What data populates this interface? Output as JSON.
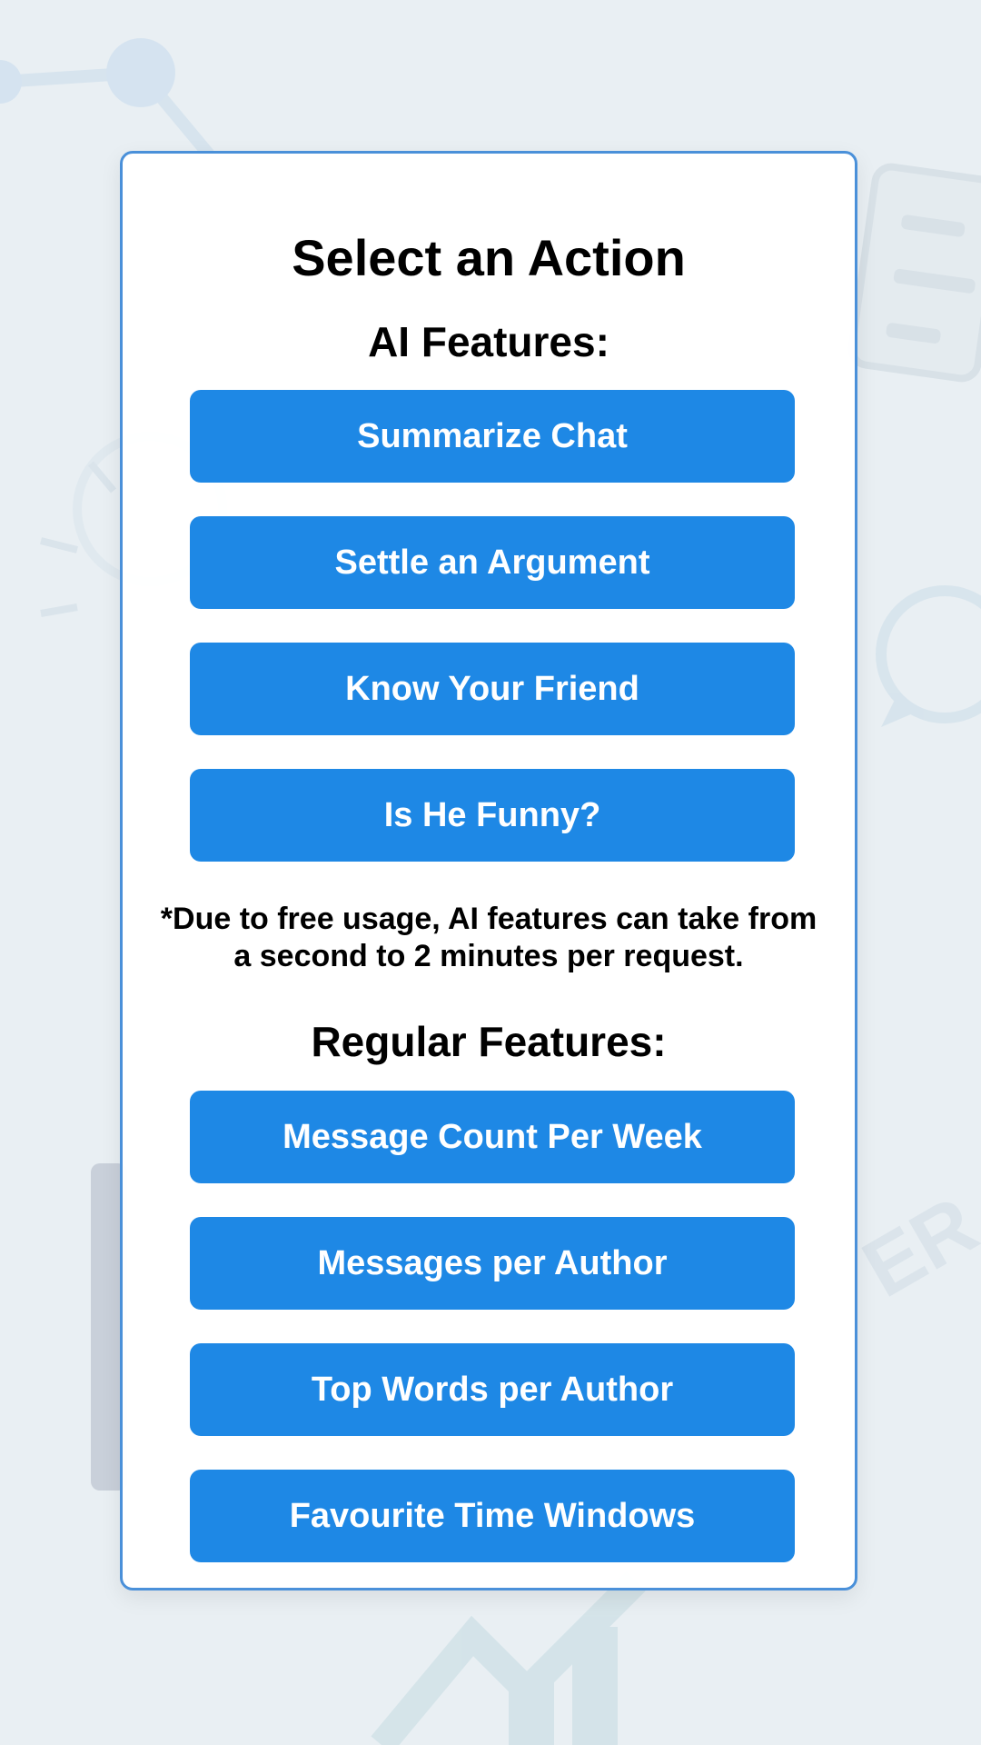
{
  "page": {
    "title": "Select an Action"
  },
  "ai_section": {
    "heading": "AI Features:",
    "buttons": [
      {
        "label": "Summarize Chat"
      },
      {
        "label": "Settle an Argument"
      },
      {
        "label": "Know Your Friend"
      },
      {
        "label": "Is He Funny?"
      }
    ],
    "note": "*Due to free usage, AI features can take from a second to 2 minutes per request."
  },
  "regular_section": {
    "heading": "Regular Features:",
    "buttons": [
      {
        "label": "Message Count Per Week"
      },
      {
        "label": "Messages per Author"
      },
      {
        "label": "Top Words per Author"
      },
      {
        "label": "Favourite Time Windows"
      }
    ]
  },
  "colors": {
    "accent": "#1e88e5",
    "card_border": "#4a90d9",
    "background": "#e9eff3"
  },
  "icons": [
    "network-graph-icon",
    "phone-icon",
    "lightbulb-icon",
    "chat-bubble-icon",
    "growth-chart-icon"
  ]
}
